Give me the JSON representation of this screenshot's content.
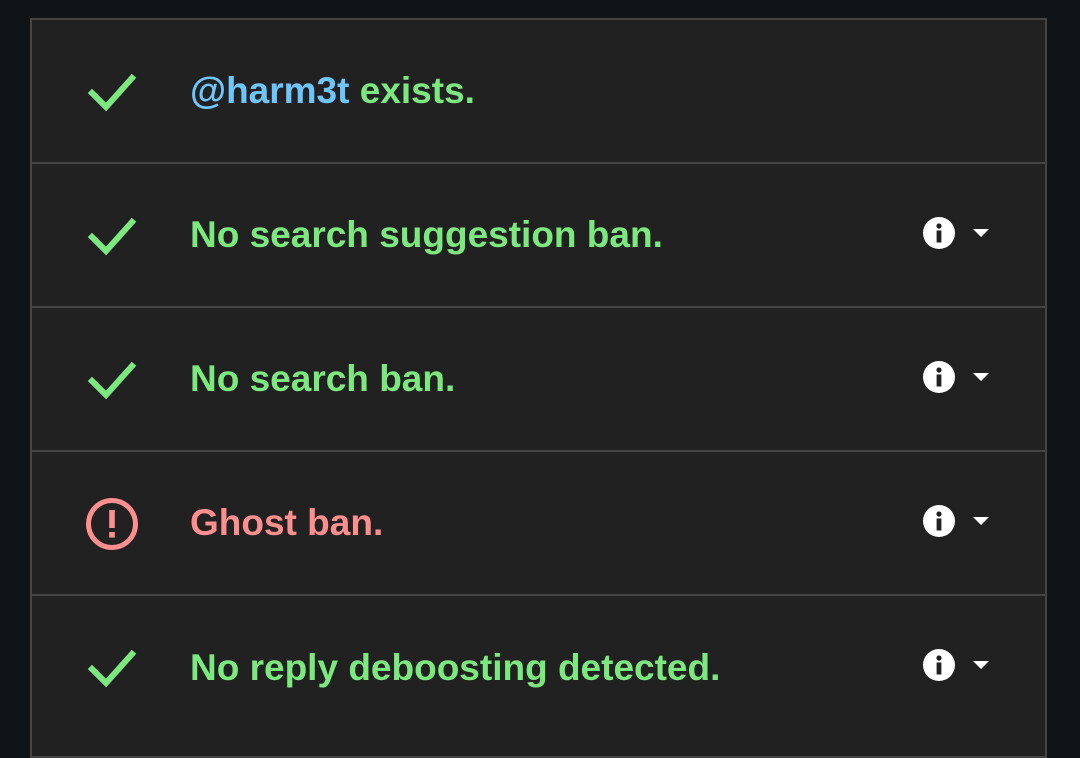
{
  "colors": {
    "success": "#7ce97f",
    "error": "#ff8f8f",
    "handle": "#6ec6ff",
    "panel_background": "#212121",
    "border": "#454545"
  },
  "rows": [
    {
      "status": "success",
      "icon": "check-icon",
      "handle": "@harm3t",
      "text": " exists.",
      "has_actions": false
    },
    {
      "status": "success",
      "icon": "check-icon",
      "text": "No search suggestion ban.",
      "has_actions": true,
      "action_icons": [
        "info-icon",
        "caret-down-icon"
      ]
    },
    {
      "status": "success",
      "icon": "check-icon",
      "text": "No search ban.",
      "has_actions": true,
      "action_icons": [
        "info-icon",
        "caret-down-icon"
      ]
    },
    {
      "status": "error",
      "icon": "alert-circle-icon",
      "text": "Ghost ban.",
      "has_actions": true,
      "action_icons": [
        "info-icon",
        "caret-down-icon"
      ]
    },
    {
      "status": "success",
      "icon": "check-icon",
      "text": "No reply deboosting detected.",
      "has_actions": true,
      "action_icons": [
        "info-icon",
        "caret-down-icon"
      ]
    }
  ]
}
